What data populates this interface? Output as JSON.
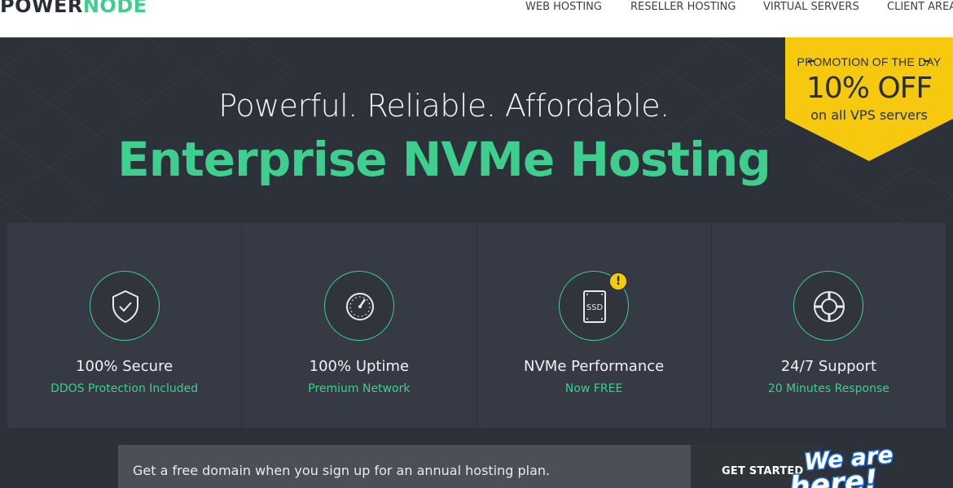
{
  "brand": {
    "part1": "POWER",
    "part2": "NODE",
    "accent_color": "#3ecf8e"
  },
  "nav": {
    "items": [
      {
        "label": "WEB HOSTING"
      },
      {
        "label": "RESELLER HOSTING"
      },
      {
        "label": "VIRTUAL SERVERS"
      },
      {
        "label": "CLIENT AREA"
      }
    ]
  },
  "hero": {
    "tagline": "Powerful. Reliable. Affordable.",
    "headline": "Enterprise NVMe Hosting"
  },
  "promo": {
    "label": "PROMOTION OF THE DAY",
    "discount": "10% OFF",
    "subtext": "on all VPS servers",
    "color": "#f6c90e"
  },
  "features": [
    {
      "title": "100% Secure",
      "subtitle": "DDOS Protection Included",
      "icon": "shield-check-icon"
    },
    {
      "title": "100% Uptime",
      "subtitle": "Premium Network",
      "icon": "speedometer-icon"
    },
    {
      "title": "NVMe Performance",
      "subtitle": "Now FREE",
      "icon": "ssd-icon",
      "alert": "!"
    },
    {
      "title": "24/7 Support",
      "subtitle": "20 Minutes Response",
      "icon": "lifebuoy-icon"
    }
  ],
  "banner": {
    "text": "Get a free domain when you sign up for an annual hosting plan.",
    "cta": "GET STARTED"
  },
  "chat": {
    "line1": "We are",
    "line2": "here!"
  }
}
